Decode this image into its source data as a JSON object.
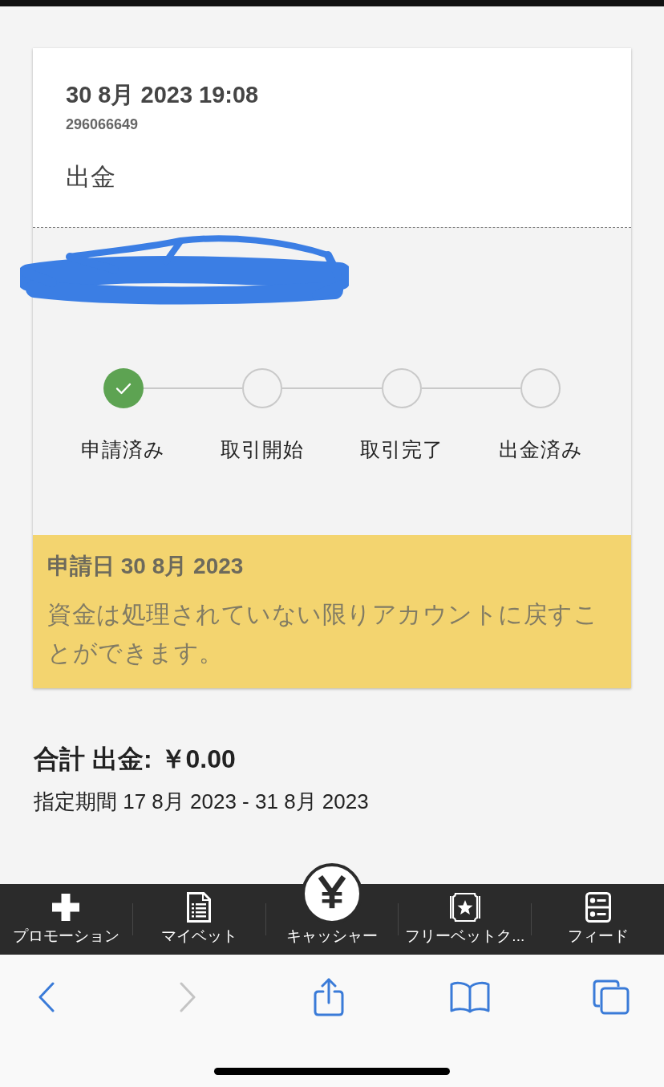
{
  "card": {
    "datetime": "30 8月 2023 19:08",
    "reference": "296066649",
    "type": "出金",
    "amount": {
      "redacted": true
    },
    "steps": [
      {
        "label": "申請済み",
        "done": true
      },
      {
        "label": "取引開始",
        "done": false
      },
      {
        "label": "取引完了",
        "done": false
      },
      {
        "label": "出金済み",
        "done": false
      }
    ],
    "notice": {
      "title": "申請日 30 8月 2023",
      "text": "資金は処理されていない限りアカウントに戻すことができます。"
    }
  },
  "total": {
    "label": "合計 出金:",
    "amount": "￥0.00",
    "period": "指定期間 17 8月 2023 - 31 8月 2023"
  },
  "bottom_nav": {
    "items": [
      {
        "label": "プロモーション",
        "kind": "plus",
        "selected": false
      },
      {
        "label": "マイベット",
        "kind": "document",
        "selected": false
      },
      {
        "label": "キャッシャー",
        "kind": "yen",
        "selected": true
      },
      {
        "label": "フリーベットク...",
        "kind": "ticket",
        "selected": false
      },
      {
        "label": "フィード",
        "kind": "feed",
        "selected": false
      }
    ]
  },
  "browser_toolbar": {
    "buttons": [
      {
        "kind": "back",
        "disabled": false
      },
      {
        "kind": "forward",
        "disabled": true
      },
      {
        "kind": "share",
        "disabled": false
      },
      {
        "kind": "bookmarks",
        "disabled": false
      },
      {
        "kind": "tabs",
        "disabled": false
      }
    ]
  }
}
